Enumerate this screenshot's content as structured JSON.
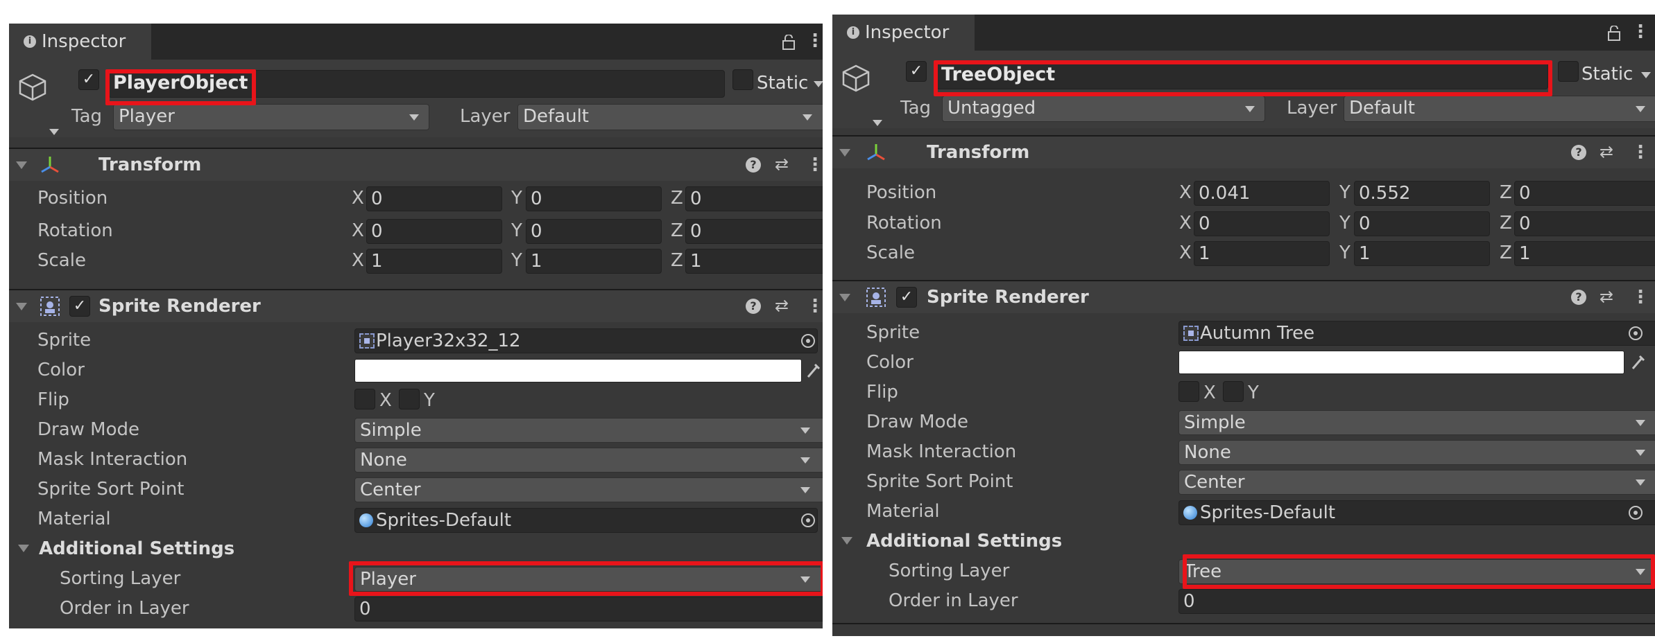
{
  "left": {
    "tab_label": "Inspector",
    "object_name": "PlayerObject",
    "static_label": "Static",
    "tag_label": "Tag",
    "tag_value": "Player",
    "layer_label": "Layer",
    "layer_value": "Default",
    "transform": {
      "title": "Transform",
      "rows": [
        {
          "label": "Position",
          "x": "0",
          "y": "0",
          "z": "0"
        },
        {
          "label": "Rotation",
          "x": "0",
          "y": "0",
          "z": "0"
        },
        {
          "label": "Scale",
          "x": "1",
          "y": "1",
          "z": "1"
        }
      ]
    },
    "sprite_renderer": {
      "title": "Sprite Renderer",
      "sprite_label": "Sprite",
      "sprite_value": "Player32x32_12",
      "color_label": "Color",
      "color_value": "#ffffff",
      "flip_label": "Flip",
      "flip_x": "X",
      "flip_y": "Y",
      "draw_mode_label": "Draw Mode",
      "draw_mode_value": "Simple",
      "mask_label": "Mask Interaction",
      "mask_value": "None",
      "sort_point_label": "Sprite Sort Point",
      "sort_point_value": "Center",
      "material_label": "Material",
      "material_value": "Sprites-Default",
      "additional_label": "Additional Settings",
      "sorting_layer_label": "Sorting Layer",
      "sorting_layer_value": "Player",
      "order_label": "Order in Layer",
      "order_value": "0"
    }
  },
  "right": {
    "tab_label": "Inspector",
    "object_name": "TreeObject",
    "static_label": "Static",
    "tag_label": "Tag",
    "tag_value": "Untagged",
    "layer_label": "Layer",
    "layer_value": "Default",
    "transform": {
      "title": "Transform",
      "rows": [
        {
          "label": "Position",
          "x": "0.041",
          "y": "0.552",
          "z": "0"
        },
        {
          "label": "Rotation",
          "x": "0",
          "y": "0",
          "z": "0"
        },
        {
          "label": "Scale",
          "x": "1",
          "y": "1",
          "z": "1"
        }
      ]
    },
    "sprite_renderer": {
      "title": "Sprite Renderer",
      "sprite_label": "Sprite",
      "sprite_value": "Autumn Tree",
      "color_label": "Color",
      "color_value": "#ffffff",
      "flip_label": "Flip",
      "flip_x": "X",
      "flip_y": "Y",
      "draw_mode_label": "Draw Mode",
      "draw_mode_value": "Simple",
      "mask_label": "Mask Interaction",
      "mask_value": "None",
      "sort_point_label": "Sprite Sort Point",
      "sort_point_value": "Center",
      "material_label": "Material",
      "material_value": "Sprites-Default",
      "additional_label": "Additional Settings",
      "sorting_layer_label": "Sorting Layer",
      "sorting_layer_value": "Tree",
      "order_label": "Order in Layer",
      "order_value": "0"
    }
  },
  "axis_labels": {
    "x": "X",
    "y": "Y",
    "z": "Z"
  },
  "colors": {
    "panel_bg": "#383838",
    "highlight": "#e8141a",
    "field_bg": "#2a2a2a",
    "dropdown_bg": "#515151"
  },
  "icons": [
    "info-icon",
    "lock-icon",
    "kebab-menu-icon",
    "gameobject-cube-icon",
    "transform-axes-icon",
    "sprite-renderer-icon",
    "help-icon",
    "presets-icon",
    "object-picker-icon",
    "eyedropper-icon",
    "sprite-asset-icon",
    "material-sphere-icon"
  ]
}
